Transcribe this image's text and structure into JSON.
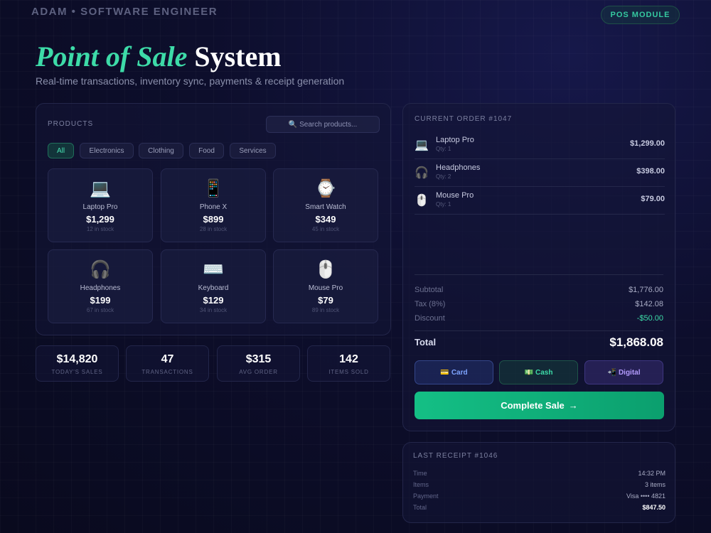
{
  "header": {
    "author": "ADAM • SOFTWARE ENGINEER",
    "badge": "POS MODULE",
    "title_accent": "Point of Sale",
    "title_main": "System",
    "subtitle": "Real-time transactions, inventory sync, payments & receipt generation"
  },
  "products": {
    "label": "PRODUCTS",
    "search_icon": "magnifier-icon",
    "search_glyph": "🔍",
    "search_placeholder": "Search products...",
    "filters": [
      "All",
      "Electronics",
      "Clothing",
      "Food",
      "Services"
    ],
    "active_filter": "All",
    "items": [
      {
        "icon": "💻",
        "icon_name": "laptop-icon",
        "name": "Laptop Pro",
        "price": "$1,299",
        "stock": "12 in stock"
      },
      {
        "icon": "📱",
        "icon_name": "phone-icon",
        "name": "Phone X",
        "price": "$899",
        "stock": "28 in stock"
      },
      {
        "icon": "⌚",
        "icon_name": "watch-icon",
        "name": "Smart Watch",
        "price": "$349",
        "stock": "45 in stock"
      },
      {
        "icon": "🎧",
        "icon_name": "headphones-icon",
        "name": "Headphones",
        "price": "$199",
        "stock": "67 in stock"
      },
      {
        "icon": "⌨️",
        "icon_name": "keyboard-icon",
        "name": "Keyboard",
        "price": "$129",
        "stock": "34 in stock"
      },
      {
        "icon": "🖱️",
        "icon_name": "mouse-icon",
        "name": "Mouse Pro",
        "price": "$79",
        "stock": "89 in stock"
      }
    ]
  },
  "stats": [
    {
      "value": "$14,820",
      "label": "TODAY'S SALES"
    },
    {
      "value": "47",
      "label": "TRANSACTIONS"
    },
    {
      "value": "$315",
      "label": "AVG ORDER"
    },
    {
      "value": "142",
      "label": "ITEMS SOLD"
    }
  ],
  "order": {
    "label": "CURRENT ORDER #1047",
    "items": [
      {
        "icon": "💻",
        "icon_name": "laptop-icon",
        "name": "Laptop Pro",
        "qty": "Qty: 1",
        "price": "$1,299.00"
      },
      {
        "icon": "🎧",
        "icon_name": "headphones-icon",
        "name": "Headphones",
        "qty": "Qty: 2",
        "price": "$398.00"
      },
      {
        "icon": "🖱️",
        "icon_name": "mouse-icon",
        "name": "Mouse Pro",
        "qty": "Qty: 1",
        "price": "$79.00"
      }
    ],
    "subtotal_label": "Subtotal",
    "subtotal": "$1,776.00",
    "tax_label": "Tax (8%)",
    "tax": "$142.08",
    "discount_label": "Discount",
    "discount": "-$50.00",
    "total_label": "Total",
    "total": "$1,868.08",
    "payments": [
      {
        "icon": "💳",
        "icon_name": "credit-card-icon",
        "label": "Card"
      },
      {
        "icon": "💵",
        "icon_name": "cash-icon",
        "label": "Cash"
      },
      {
        "icon": "📲",
        "icon_name": "mobile-payment-icon",
        "label": "Digital"
      }
    ],
    "complete_label": "Complete Sale",
    "complete_arrow": "→"
  },
  "receipt": {
    "label": "LAST RECEIPT #1046",
    "rows": [
      {
        "label": "Time",
        "value": "14:32 PM"
      },
      {
        "label": "Items",
        "value": "3 items"
      },
      {
        "label": "Payment",
        "value": "Visa •••• 4821"
      },
      {
        "label": "Total",
        "value": "$847.50"
      }
    ]
  },
  "colors": {
    "accent": "#3ddba8",
    "complete_button": "#14bf85",
    "card": "#7ea4ff",
    "digital": "#b59cff"
  }
}
